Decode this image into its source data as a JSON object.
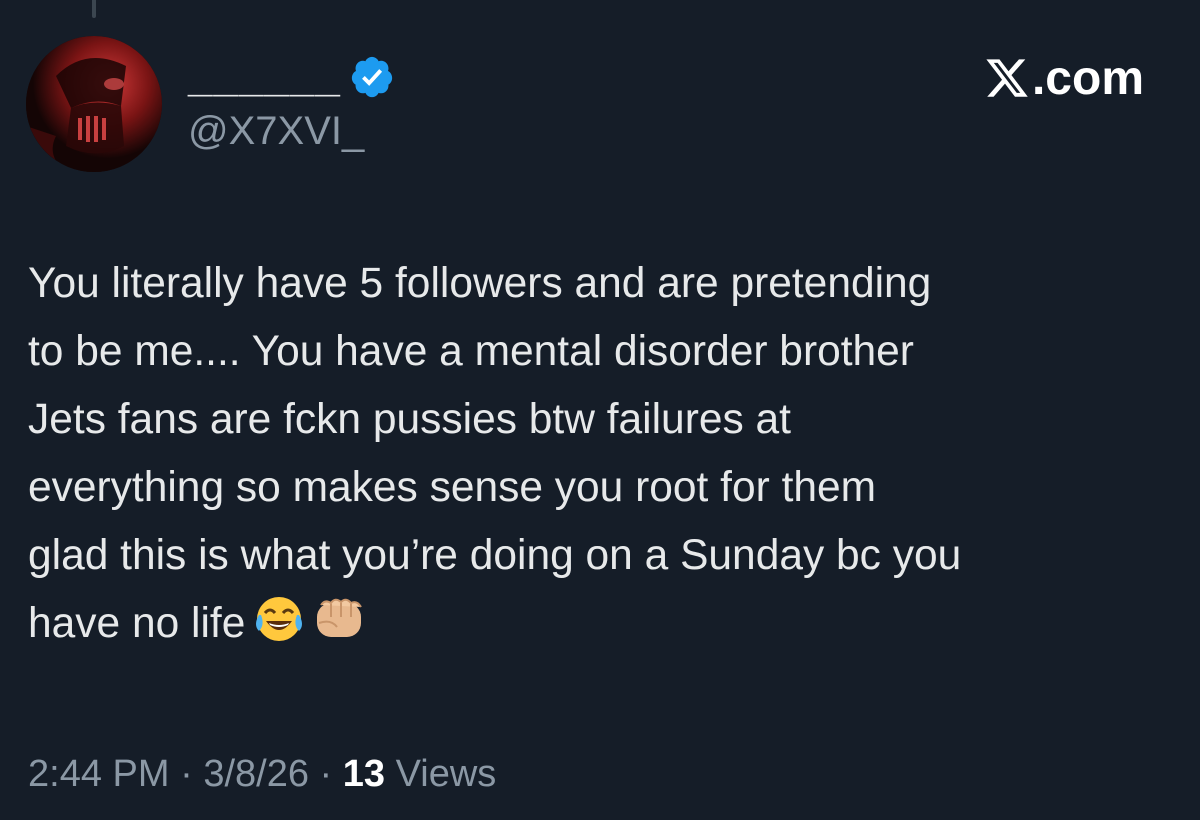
{
  "tweet": {
    "display_name": "______",
    "handle": "@X7XVI_",
    "verified_icon": "verified-badge-icon",
    "avatar_icon": "dark-helmet-avatar",
    "site": "X.com",
    "body": "You literally have 5 followers and are pretending\nto be me.... You have a mental disorder brother\nJets fans are fckn pussies btw failures at\neverything so makes sense you root for them\nglad this is what you’re doing on a Sunday bc you\nhave no life",
    "emojis": [
      "face-with-tears-of-joy",
      "oncoming-fist"
    ],
    "time": "2:44 PM",
    "date": "3/8/26",
    "views_count": "13",
    "views_label": "Views",
    "separator": "·"
  },
  "colors": {
    "background": "#151d28",
    "verified_blue": "#1d9bf0",
    "text": "#e7e9ea",
    "muted": "#8b98a5"
  }
}
